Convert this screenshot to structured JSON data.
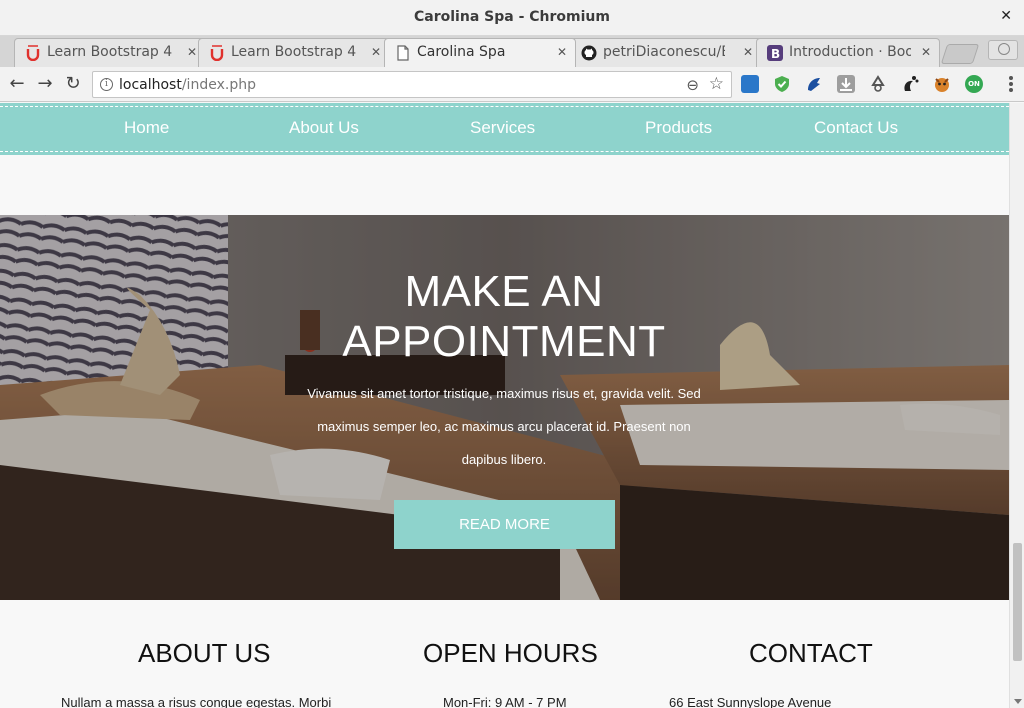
{
  "window": {
    "title": "Carolina Spa - Chromium",
    "close_glyph": "✕"
  },
  "tabs": [
    {
      "label": "Learn Bootstrap 4",
      "icon": "udemy-icon",
      "active": false
    },
    {
      "label": "Learn Bootstrap 4",
      "icon": "udemy-icon",
      "active": false
    },
    {
      "label": "Carolina Spa",
      "icon": "page-icon",
      "active": true
    },
    {
      "label": "petriDiaconescu/Bo",
      "icon": "github-icon",
      "active": false
    },
    {
      "label": "Introduction · Boot",
      "icon": "bootstrap-icon",
      "active": false
    }
  ],
  "tab_close_glyph": "✕",
  "toolbar": {
    "back_glyph": "←",
    "forward_glyph": "→",
    "reload_glyph": "↻",
    "url_host": "localhost",
    "url_path": "/index.php",
    "info_glyph": "i",
    "zoom_glyph": "⊖",
    "star_glyph": "☆",
    "extensions": [
      "extension-blue-icon",
      "shield-check-icon",
      "extension-dark-blue-icon",
      "download-icon",
      "recycle-icon",
      "gnome-icon",
      "fox-icon",
      "on-badge-icon"
    ],
    "on_badge": "ON"
  },
  "site_nav": {
    "links": [
      "Home",
      "About Us",
      "Services",
      "Products",
      "Contact Us"
    ],
    "background": "#8ed3cc"
  },
  "hero": {
    "title_line1": "MAKE AN",
    "title_line2": "APPOINTMENT",
    "body": "Vivamus sit amet tortor tristique, maximus risus et, gravida velit. Sed maximus semper leo, ac maximus arcu placerat id. Praesent non dapibus libero.",
    "button": "READ MORE"
  },
  "sections": [
    {
      "heading": "ABOUT US",
      "text": "Nullam a massa a risus congue egestas. Morbi"
    },
    {
      "heading": "OPEN HOURS",
      "text": "Mon-Fri: 9 AM - 7 PM"
    },
    {
      "heading": "CONTACT",
      "text": "66 East Sunnyslope Avenue"
    }
  ],
  "accent_color": "#8ed3cc"
}
